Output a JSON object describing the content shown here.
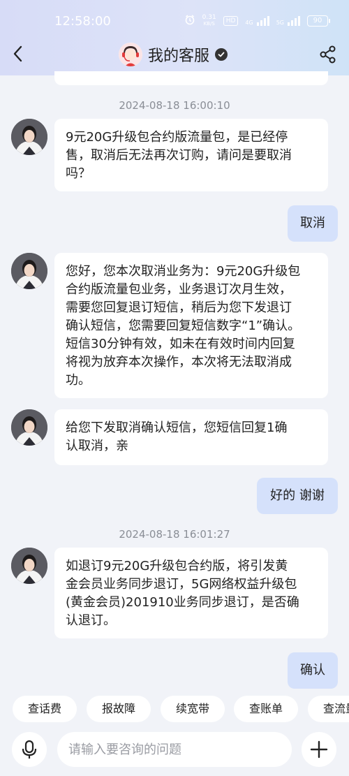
{
  "status_bar": {
    "time": "12:58:00",
    "net_speed_value": "0.31",
    "net_speed_unit": "KB/S",
    "hd_label": "HD",
    "sig1_label": "4G",
    "sig2_label": "5G",
    "battery": "90"
  },
  "header": {
    "title": "我的客服"
  },
  "messages": [
    {
      "type": "timestamp",
      "text": "2024-08-18 16:00:10"
    },
    {
      "type": "incoming",
      "text": "9元20G升级包合约版流量包，是已经停\n售，取消后无法再次订购，请问是要取消\n吗？"
    },
    {
      "type": "outgoing",
      "text": "取消"
    },
    {
      "type": "incoming",
      "text": "您好，您本次取消业务为：9元20G升级包\n合约版流量包业务，业务退订次月生效，\n需要您回复退订短信，稍后为您下发退订\n确认短信，您需要回复短信数字“1”确认。\n短信30分钟有效，如未在有效时间内回复\n将视为放弃本次操作，本次将无法取消成\n功。"
    },
    {
      "type": "incoming",
      "text": "给您下发取消确认短信，您短信回复1确\n认取消，亲"
    },
    {
      "type": "outgoing",
      "text": "好的 谢谢"
    },
    {
      "type": "timestamp",
      "text": "2024-08-18 16:01:27"
    },
    {
      "type": "incoming",
      "text": "如退订9元20G升级包合约版，将引发黄\n金会员业务同步退订，5G网络权益升级包\n(黄金会员)201910业务同步退订，是否确\n认退订。"
    },
    {
      "type": "outgoing",
      "text": "确认"
    }
  ],
  "quick_replies": [
    "查话费",
    "报故障",
    "续宽带",
    "查账单",
    "查流量"
  ],
  "input": {
    "placeholder": "请输入要咨询的问题"
  },
  "colors": {
    "outgoing_bubble": "#d5e1fb",
    "background": "#f1f3f8"
  },
  "icons": {
    "back": "back-arrow-icon",
    "share": "share-icon",
    "verified": "verified-check-icon",
    "mic": "microphone-icon",
    "plus": "plus-icon"
  }
}
